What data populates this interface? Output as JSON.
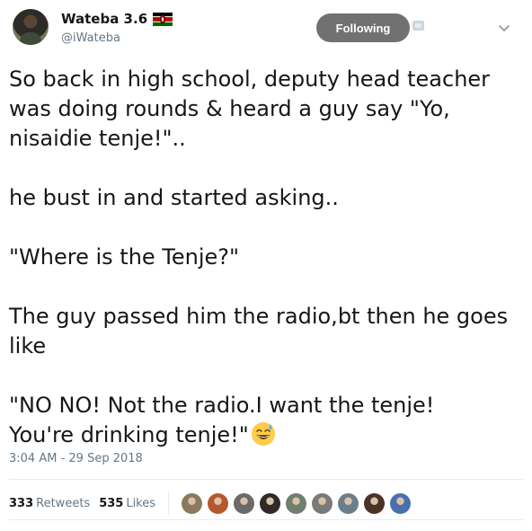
{
  "tweet": {
    "author": {
      "name": "Wateba 3.6",
      "handle": "@iWateba",
      "flag": "kenya-flag"
    },
    "follow_button": {
      "label": "Following"
    },
    "text": "So back in high school, deputy head teacher was doing rounds & heard a guy say \"Yo, nisaidie tenje!\"..\n\nhe bust in and started asking..\n\n\"Where is the Tenje?\"\n\nThe guy passed him the radio,bt then he goes like\n\n\"NO NO! Not the radio.I want the tenje!\nYou're drinking tenje!\"",
    "emoji": "grinning-face-with-sweat",
    "timestamp": "3:04 AM - 29 Sep 2018",
    "stats": {
      "retweets_count": "333",
      "retweets_label": "Retweets",
      "likes_count": "535",
      "likes_label": "Likes"
    },
    "likers": [
      {
        "color": "#8a7a5c"
      },
      {
        "color": "#b8562e"
      },
      {
        "color": "#6a6a6a"
      },
      {
        "color": "#2f2a28"
      },
      {
        "color": "#6e7f6e"
      },
      {
        "color": "#7a7a7a"
      },
      {
        "color": "#6b7e8c"
      },
      {
        "color": "#4a3326"
      },
      {
        "color": "#4a6fb0"
      }
    ]
  }
}
